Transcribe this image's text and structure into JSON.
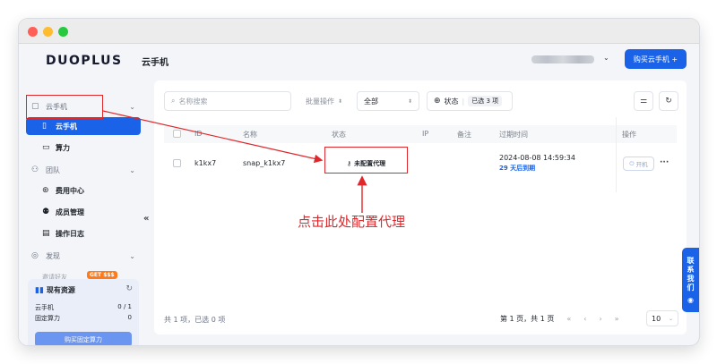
{
  "app": {
    "logo": "DUOPLUS"
  },
  "sidebar": {
    "groups": [
      {
        "label": "云手机",
        "icon": "phone-group-icon"
      },
      {
        "label": "团队",
        "icon": "team-icon"
      },
      {
        "label": "发现",
        "icon": "discover-icon"
      }
    ],
    "items": [
      {
        "label": "云手机",
        "icon": "phone-icon",
        "active": true
      },
      {
        "label": "算力",
        "icon": "monitor-icon"
      },
      {
        "label": "费用中心",
        "icon": "coin-icon"
      },
      {
        "label": "成员管理",
        "icon": "members-icon"
      },
      {
        "label": "操作日志",
        "icon": "log-icon"
      }
    ],
    "discover_badge": "GET $$$",
    "discover_partial": "邀请好友",
    "resources": {
      "title": "现有资源",
      "rows": [
        {
          "label": "云手机",
          "value": "0 / 1"
        },
        {
          "label": "固定算力",
          "value": "0"
        }
      ],
      "button": "购买固定算力"
    },
    "collapse": "«"
  },
  "header": {
    "title": "云手机",
    "account_chevron": "⌄",
    "buy_button": "购买云手机 +"
  },
  "toolbar": {
    "search_placeholder": "名称搜索",
    "batch": "批量操作",
    "filter_all": "全部",
    "status_label": "状态",
    "status_selected": "已选 3 项"
  },
  "table": {
    "columns": [
      "ID",
      "名称",
      "状态",
      "IP",
      "备注",
      "过期时间",
      "操作"
    ],
    "rows": [
      {
        "id": "k1kx7",
        "name": "snap_k1kx7",
        "status": "未配置代理",
        "ip": "",
        "remark": "",
        "expire_date": "2024-08-08 14:59:34",
        "expire_remaining": "29 天后到期",
        "power_button": "开机",
        "more": "···"
      }
    ]
  },
  "footer": {
    "count": "共 1 项，已选 0 项",
    "page_info": "第 1 页，共 1 页",
    "page_size": "10"
  },
  "annotation": {
    "text": "点击此处配置代理",
    "color": "#e0272b"
  },
  "contact": {
    "label": [
      "联",
      "系",
      "我",
      "们"
    ]
  },
  "colors": {
    "accent": "#1a63e8",
    "annotation": "#e0272b"
  }
}
